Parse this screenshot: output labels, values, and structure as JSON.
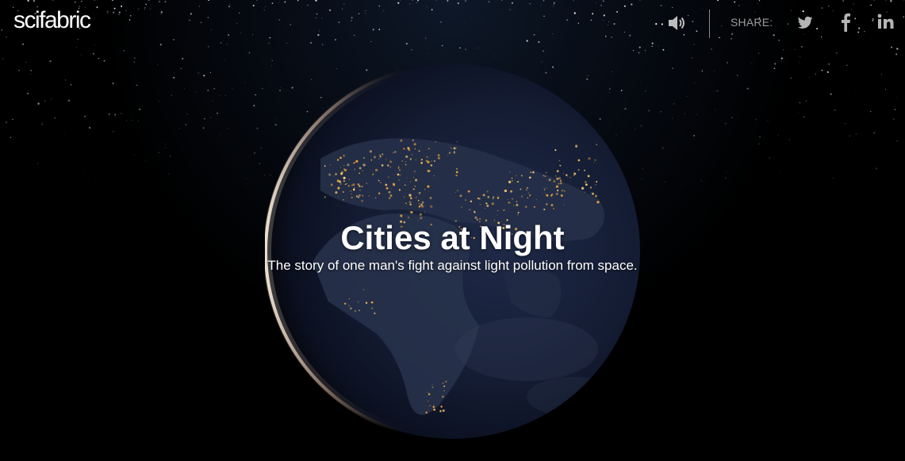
{
  "brand": {
    "logo_text": "scifabric"
  },
  "topbar": {
    "sound_icon": "speaker-volume-icon",
    "share_label": "SHARE:",
    "social": [
      {
        "name": "twitter",
        "icon": "twitter-icon"
      },
      {
        "name": "facebook",
        "icon": "facebook-icon"
      },
      {
        "name": "linkedin",
        "icon": "linkedin-icon"
      }
    ]
  },
  "hero": {
    "title": "Cities at Night",
    "subtitle": "The story of one man's fight against light pollution from space."
  },
  "colors": {
    "background": "#000000",
    "text": "#ffffff",
    "muted": "#9c9c9c",
    "city_lights": "#f4b94a",
    "earth": "#1b2540"
  }
}
